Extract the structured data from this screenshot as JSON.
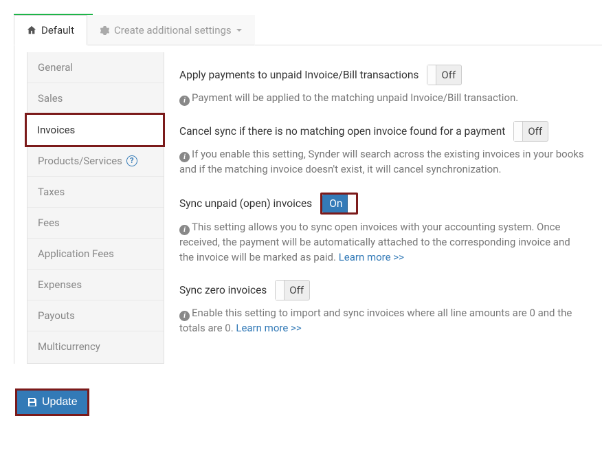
{
  "tabs": {
    "default": "Default",
    "create_additional": "Create additional settings"
  },
  "sidebar": {
    "items": [
      {
        "label": "General"
      },
      {
        "label": "Sales"
      },
      {
        "label": "Invoices"
      },
      {
        "label": "Products/Services"
      },
      {
        "label": "Taxes"
      },
      {
        "label": "Fees"
      },
      {
        "label": "Application Fees"
      },
      {
        "label": "Expenses"
      },
      {
        "label": "Payouts"
      },
      {
        "label": "Multicurrency"
      }
    ]
  },
  "settings": {
    "apply_payments": {
      "label": "Apply payments to unpaid Invoice/Bill transactions",
      "state": "Off",
      "help": "Payment will be applied to the matching unpaid Invoice/Bill transaction."
    },
    "cancel_sync": {
      "label": "Cancel sync if there is no matching open invoice found for a payment",
      "state": "Off",
      "help": "If you enable this setting, Synder will search across the existing invoices in your books and if the matching invoice doesn't exist, it will cancel synchronization."
    },
    "sync_unpaid": {
      "label": "Sync unpaid (open) invoices",
      "state": "On",
      "help": "This setting allows you to sync open invoices with your accounting system. Once received, the payment will be automatically attached to the corresponding invoice and the invoice will be marked as paid.",
      "learn_more": "Learn more >>"
    },
    "sync_zero": {
      "label": "Sync zero invoices",
      "state": "Off",
      "help": "Enable this setting to import and sync invoices where all line amounts are 0 and the totals are 0.",
      "learn_more": "Learn more >>"
    }
  },
  "buttons": {
    "update": "Update"
  }
}
